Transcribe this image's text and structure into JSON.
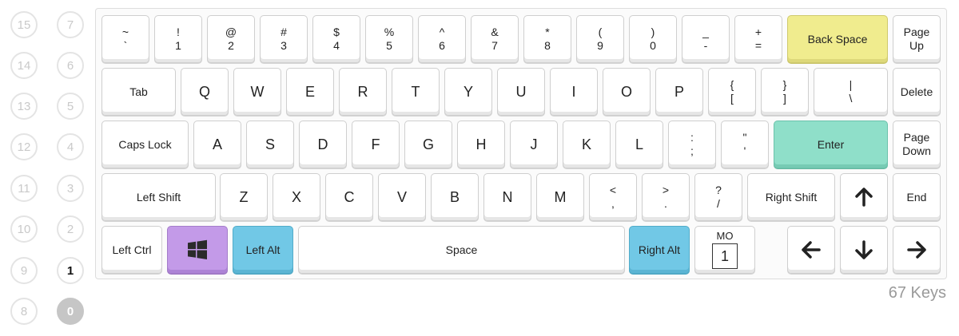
{
  "layers": {
    "column_left": [
      "15",
      "14",
      "13",
      "12",
      "11",
      "10",
      "9",
      "8"
    ],
    "column_right": [
      "7",
      "6",
      "5",
      "4",
      "3",
      "2",
      "1",
      "0"
    ],
    "selected": "0",
    "highlighted": "1"
  },
  "keys": {
    "tilde": {
      "top": "~",
      "bot": "`"
    },
    "k1": {
      "top": "!",
      "bot": "1"
    },
    "k2": {
      "top": "@",
      "bot": "2"
    },
    "k3": {
      "top": "#",
      "bot": "3"
    },
    "k4": {
      "top": "$",
      "bot": "4"
    },
    "k5": {
      "top": "%",
      "bot": "5"
    },
    "k6": {
      "top": "^",
      "bot": "6"
    },
    "k7": {
      "top": "&",
      "bot": "7"
    },
    "k8": {
      "top": "*",
      "bot": "8"
    },
    "k9": {
      "top": "(",
      "bot": "9"
    },
    "k0": {
      "top": ")",
      "bot": "0"
    },
    "minus": {
      "top": "_",
      "bot": "-"
    },
    "equal": {
      "top": "+",
      "bot": "="
    },
    "backspace": "Back Space",
    "pageup": {
      "top": "Page",
      "bot": "Up"
    },
    "tab": "Tab",
    "q": "Q",
    "w": "W",
    "e": "E",
    "r": "R",
    "t": "T",
    "y": "Y",
    "u": "U",
    "i": "I",
    "o": "O",
    "p": "P",
    "lbracket": {
      "top": "{",
      "bot": "["
    },
    "rbracket": {
      "top": "}",
      "bot": "]"
    },
    "backslash": {
      "top": "|",
      "bot": "\\"
    },
    "delete": "Delete",
    "capslock": "Caps Lock",
    "a": "A",
    "s": "S",
    "d": "D",
    "f": "F",
    "g": "G",
    "h": "H",
    "j": "J",
    "k": "K",
    "l": "L",
    "semicolon": {
      "top": ":",
      "bot": ";"
    },
    "quote": {
      "top": "\"",
      "bot": "'"
    },
    "enter": "Enter",
    "pagedown": {
      "top": "Page",
      "bot": "Down"
    },
    "lshift": "Left Shift",
    "z": "Z",
    "x": "X",
    "c": "C",
    "v": "V",
    "b": "B",
    "n": "N",
    "m": "M",
    "comma": {
      "top": "<",
      "bot": ","
    },
    "period": {
      "top": ">",
      "bot": "."
    },
    "slash": {
      "top": "?",
      "bot": "/"
    },
    "rshift": "Right Shift",
    "end": "End",
    "lctrl": "Left Ctrl",
    "lalt": "Left Alt",
    "space": "Space",
    "ralt": "Right Alt",
    "mo": {
      "label": "MO",
      "value": "1"
    }
  },
  "icons": {
    "win": "windows-logo-icon",
    "up": "arrow-up-icon",
    "left": "arrow-left-icon",
    "down": "arrow-down-icon",
    "right": "arrow-right-icon"
  },
  "colors": {
    "backspace": "#f0ec8e",
    "enter": "#8fdfc9",
    "alt": "#71c8e6",
    "win": "#c39ae8"
  },
  "key_count": "67 Keys"
}
